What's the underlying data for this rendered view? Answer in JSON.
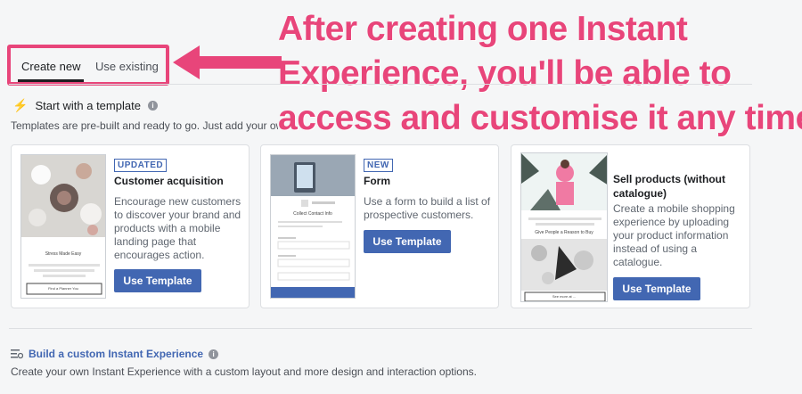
{
  "tabs": {
    "create_new": "Create new",
    "use_existing": "Use existing"
  },
  "callout": {
    "line1": "After creating one Instant",
    "line2": "Experience, you'll be able to",
    "line3": "access and customise it any time!"
  },
  "template_section": {
    "title": "Start with a template",
    "subtitle": "Templates are pre-built and ready to go. Just add your own"
  },
  "cards": [
    {
      "badge": "UPDATED",
      "title": "Customer acquisition",
      "description_lines": [
        "Encourage new customers",
        "to discover your brand and",
        "products with a mobile",
        "landing page that",
        "encourages action."
      ],
      "button": "Use Template",
      "thumb_caption": "Stress Made Easy",
      "thumb_button": "Find a Planner You"
    },
    {
      "badge": "NEW",
      "title": "Form",
      "description_lines": [
        "Use a form to build a list of",
        "prospective customers."
      ],
      "button": "Use Template",
      "thumb_heading": "Collect Contact Info"
    },
    {
      "title_lines": [
        "Sell products (without",
        "catalogue)"
      ],
      "description_lines": [
        "Create a mobile shopping",
        "experience by uploading",
        "your product information",
        "instead of using a",
        "catalogue."
      ],
      "button": "Use Template",
      "thumb_caption": "Give People a Reason to Buy",
      "thumb_button": "See more at ..."
    }
  ],
  "custom_section": {
    "title": "Build a custom Instant Experience",
    "subtitle": "Create your own Instant Experience with a custom layout and more design and interaction options."
  },
  "colors": {
    "accent": "#e8457a",
    "brand_blue": "#4267b2"
  }
}
